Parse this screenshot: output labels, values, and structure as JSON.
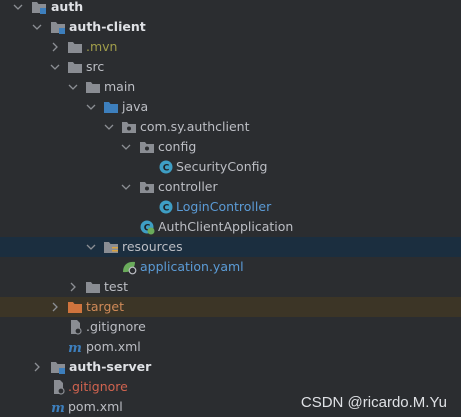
{
  "tree": {
    "auth": "auth",
    "auth_client": "auth-client",
    "mvn": ".mvn",
    "src": "src",
    "main": "main",
    "java": "java",
    "package": "com.sy.authclient",
    "config": "config",
    "security_config": "SecurityConfig",
    "controller": "controller",
    "login_controller": "LoginController",
    "auth_client_application": "AuthClientApplication",
    "resources": "resources",
    "application_yaml": "application.yaml",
    "test": "test",
    "target": "target",
    "gitignore_client": ".gitignore",
    "pom_client": "pom.xml",
    "auth_server": "auth-server",
    "gitignore_root": ".gitignore",
    "pom_root": "pom.xml"
  },
  "watermark": "CSDN @ricardo.M.Yu",
  "colors": {
    "background": "#2b2d30",
    "selected_row": "#1b2e3f",
    "highlighted_row": "#3c3526",
    "folder": "#8a8d93",
    "module_folder": "#3d7fbd",
    "class_icon": "#3e9ec4",
    "excluded_folder": "#d0743d"
  },
  "icons": {
    "folder": "folder-icon",
    "module": "module-folder-icon",
    "class": "class-icon",
    "package": "package-icon",
    "yaml": "yaml-config-icon",
    "maven": "maven-icon",
    "gitignore": "gitignore-icon",
    "spring_app": "spring-boot-app-icon"
  }
}
